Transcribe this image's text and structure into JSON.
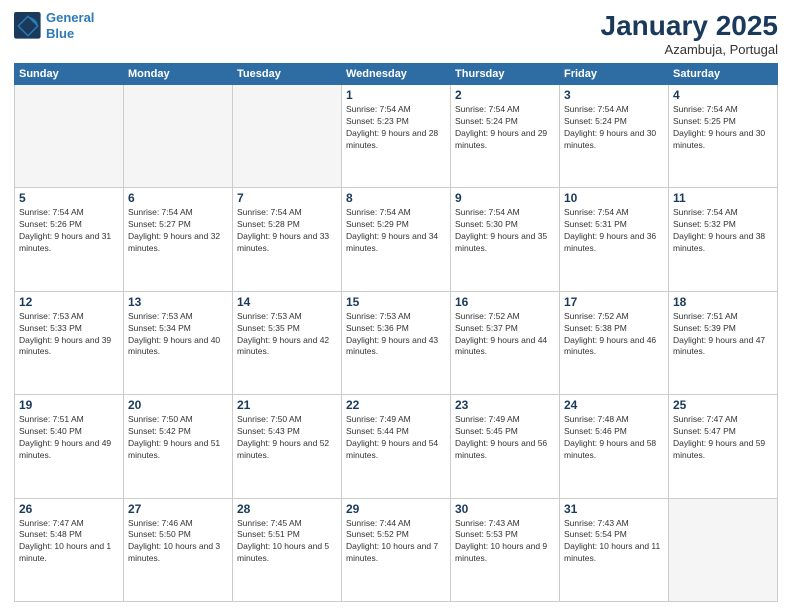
{
  "logo": {
    "line1": "General",
    "line2": "Blue"
  },
  "title": "January 2025",
  "subtitle": "Azambuja, Portugal",
  "weekdays": [
    "Sunday",
    "Monday",
    "Tuesday",
    "Wednesday",
    "Thursday",
    "Friday",
    "Saturday"
  ],
  "weeks": [
    [
      {
        "day": "",
        "info": ""
      },
      {
        "day": "",
        "info": ""
      },
      {
        "day": "",
        "info": ""
      },
      {
        "day": "1",
        "info": "Sunrise: 7:54 AM\nSunset: 5:23 PM\nDaylight: 9 hours and 28 minutes."
      },
      {
        "day": "2",
        "info": "Sunrise: 7:54 AM\nSunset: 5:24 PM\nDaylight: 9 hours and 29 minutes."
      },
      {
        "day": "3",
        "info": "Sunrise: 7:54 AM\nSunset: 5:24 PM\nDaylight: 9 hours and 30 minutes."
      },
      {
        "day": "4",
        "info": "Sunrise: 7:54 AM\nSunset: 5:25 PM\nDaylight: 9 hours and 30 minutes."
      }
    ],
    [
      {
        "day": "5",
        "info": "Sunrise: 7:54 AM\nSunset: 5:26 PM\nDaylight: 9 hours and 31 minutes."
      },
      {
        "day": "6",
        "info": "Sunrise: 7:54 AM\nSunset: 5:27 PM\nDaylight: 9 hours and 32 minutes."
      },
      {
        "day": "7",
        "info": "Sunrise: 7:54 AM\nSunset: 5:28 PM\nDaylight: 9 hours and 33 minutes."
      },
      {
        "day": "8",
        "info": "Sunrise: 7:54 AM\nSunset: 5:29 PM\nDaylight: 9 hours and 34 minutes."
      },
      {
        "day": "9",
        "info": "Sunrise: 7:54 AM\nSunset: 5:30 PM\nDaylight: 9 hours and 35 minutes."
      },
      {
        "day": "10",
        "info": "Sunrise: 7:54 AM\nSunset: 5:31 PM\nDaylight: 9 hours and 36 minutes."
      },
      {
        "day": "11",
        "info": "Sunrise: 7:54 AM\nSunset: 5:32 PM\nDaylight: 9 hours and 38 minutes."
      }
    ],
    [
      {
        "day": "12",
        "info": "Sunrise: 7:53 AM\nSunset: 5:33 PM\nDaylight: 9 hours and 39 minutes."
      },
      {
        "day": "13",
        "info": "Sunrise: 7:53 AM\nSunset: 5:34 PM\nDaylight: 9 hours and 40 minutes."
      },
      {
        "day": "14",
        "info": "Sunrise: 7:53 AM\nSunset: 5:35 PM\nDaylight: 9 hours and 42 minutes."
      },
      {
        "day": "15",
        "info": "Sunrise: 7:53 AM\nSunset: 5:36 PM\nDaylight: 9 hours and 43 minutes."
      },
      {
        "day": "16",
        "info": "Sunrise: 7:52 AM\nSunset: 5:37 PM\nDaylight: 9 hours and 44 minutes."
      },
      {
        "day": "17",
        "info": "Sunrise: 7:52 AM\nSunset: 5:38 PM\nDaylight: 9 hours and 46 minutes."
      },
      {
        "day": "18",
        "info": "Sunrise: 7:51 AM\nSunset: 5:39 PM\nDaylight: 9 hours and 47 minutes."
      }
    ],
    [
      {
        "day": "19",
        "info": "Sunrise: 7:51 AM\nSunset: 5:40 PM\nDaylight: 9 hours and 49 minutes."
      },
      {
        "day": "20",
        "info": "Sunrise: 7:50 AM\nSunset: 5:42 PM\nDaylight: 9 hours and 51 minutes."
      },
      {
        "day": "21",
        "info": "Sunrise: 7:50 AM\nSunset: 5:43 PM\nDaylight: 9 hours and 52 minutes."
      },
      {
        "day": "22",
        "info": "Sunrise: 7:49 AM\nSunset: 5:44 PM\nDaylight: 9 hours and 54 minutes."
      },
      {
        "day": "23",
        "info": "Sunrise: 7:49 AM\nSunset: 5:45 PM\nDaylight: 9 hours and 56 minutes."
      },
      {
        "day": "24",
        "info": "Sunrise: 7:48 AM\nSunset: 5:46 PM\nDaylight: 9 hours and 58 minutes."
      },
      {
        "day": "25",
        "info": "Sunrise: 7:47 AM\nSunset: 5:47 PM\nDaylight: 9 hours and 59 minutes."
      }
    ],
    [
      {
        "day": "26",
        "info": "Sunrise: 7:47 AM\nSunset: 5:48 PM\nDaylight: 10 hours and 1 minute."
      },
      {
        "day": "27",
        "info": "Sunrise: 7:46 AM\nSunset: 5:50 PM\nDaylight: 10 hours and 3 minutes."
      },
      {
        "day": "28",
        "info": "Sunrise: 7:45 AM\nSunset: 5:51 PM\nDaylight: 10 hours and 5 minutes."
      },
      {
        "day": "29",
        "info": "Sunrise: 7:44 AM\nSunset: 5:52 PM\nDaylight: 10 hours and 7 minutes."
      },
      {
        "day": "30",
        "info": "Sunrise: 7:43 AM\nSunset: 5:53 PM\nDaylight: 10 hours and 9 minutes."
      },
      {
        "day": "31",
        "info": "Sunrise: 7:43 AM\nSunset: 5:54 PM\nDaylight: 10 hours and 11 minutes."
      },
      {
        "day": "",
        "info": ""
      }
    ]
  ]
}
